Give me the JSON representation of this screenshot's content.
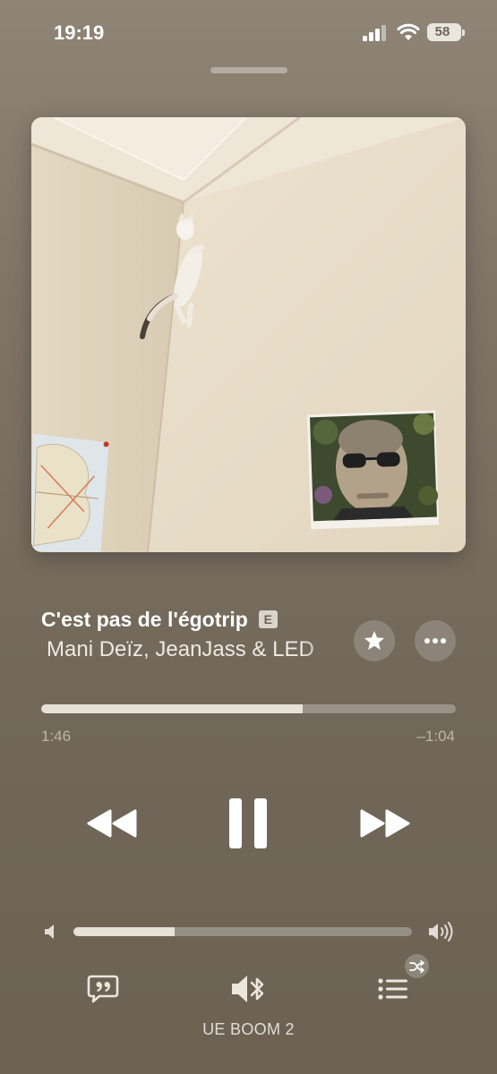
{
  "status_bar": {
    "time": "19:19",
    "battery_level": "58"
  },
  "now_playing": {
    "title": "C'est pas de l'égotrip",
    "explicit_badge": "E",
    "artist": "Mani Deïz, JeanJass & LED",
    "favorited": true
  },
  "playback": {
    "elapsed": "1:46",
    "remaining": "–1:04",
    "progress_fraction": 0.63,
    "state": "playing"
  },
  "volume": {
    "level_fraction": 0.3
  },
  "output": {
    "device_name": "UE BOOM 2"
  },
  "icons": {
    "signal": "cellular-signal-icon",
    "wifi": "wifi-icon",
    "battery": "battery-icon",
    "star": "star-icon",
    "more": "ellipsis-icon",
    "rewind": "rewind-icon",
    "pause": "pause-icon",
    "forward": "fast-forward-icon",
    "volume_low": "speaker-low-icon",
    "volume_high": "speaker-high-icon",
    "lyrics": "lyrics-bubble-icon",
    "airplay": "speaker-bluetooth-icon",
    "queue": "queue-list-icon",
    "shuffle": "shuffle-icon"
  },
  "colors": {
    "background": "#7e7466",
    "accent_fill": "#e7e1d8",
    "secondary_text": "#bdb5aa"
  }
}
